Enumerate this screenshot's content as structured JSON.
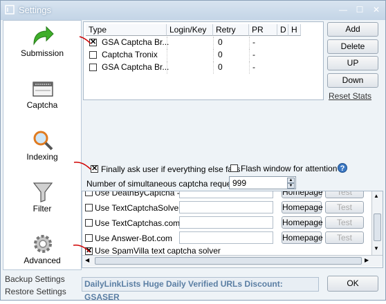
{
  "window": {
    "title": "Settings",
    "min": "—",
    "max": "☐",
    "close": "✕"
  },
  "sidebar": {
    "items": [
      {
        "label": "Submission",
        "icon": "green-arrow-icon"
      },
      {
        "label": "Captcha",
        "icon": "captcha-icon"
      },
      {
        "label": "Indexing",
        "icon": "indexing-icon"
      },
      {
        "label": "Filter",
        "icon": "funnel-icon"
      },
      {
        "label": "Advanced",
        "icon": "gear-icon"
      }
    ],
    "backup": "Backup Settings",
    "restore": "Restore Settings"
  },
  "grid": {
    "columns": [
      "Type",
      "Login/Key",
      "Retry",
      "PR",
      "D",
      "H"
    ],
    "rows": [
      {
        "type": "GSA Captcha Br...",
        "login": "",
        "retry": "0",
        "pr": "-",
        "checked": true
      },
      {
        "type": "Captcha Tronix",
        "login": "",
        "retry": "0",
        "pr": "-",
        "checked": false
      },
      {
        "type": "GSA Captcha Br...",
        "login": "",
        "retry": "0",
        "pr": "-",
        "checked": false
      }
    ]
  },
  "buttons": {
    "add": "Add",
    "delete": "Delete",
    "up": "UP",
    "down": "Down",
    "reset": "Reset Stats",
    "ok": "OK"
  },
  "options": {
    "finally_ask": "Finally ask user if everything else fails",
    "flash_window": "Flash window for attention",
    "help": "?",
    "num_requests_label": "Number of simultaneous captcha requests",
    "num_requests_value": "999"
  },
  "solvers": [
    {
      "label": "Use DeathByCaptcha - Key",
      "checked": false,
      "homepage": "Homepage",
      "test": "Test"
    },
    {
      "label": "Use TextCaptchaSolver",
      "checked": false,
      "homepage": "Homepage",
      "test": "Test"
    },
    {
      "label": "Use TextCaptchas.com",
      "checked": false,
      "homepage": "Homepage",
      "test": "Test"
    },
    {
      "label": "Use Answer-Bot.com",
      "checked": false,
      "homepage": "Homepage",
      "test": "Test"
    },
    {
      "label": "Use SpamVilla text captcha solver",
      "checked": true
    }
  ],
  "promo": "DailyLinkLists Huge Daily Verified URLs Discount: GSASER",
  "colors": {
    "accent": "#5a7ea3",
    "annotation": "#d00000",
    "window_bg": "#eef3f7"
  }
}
